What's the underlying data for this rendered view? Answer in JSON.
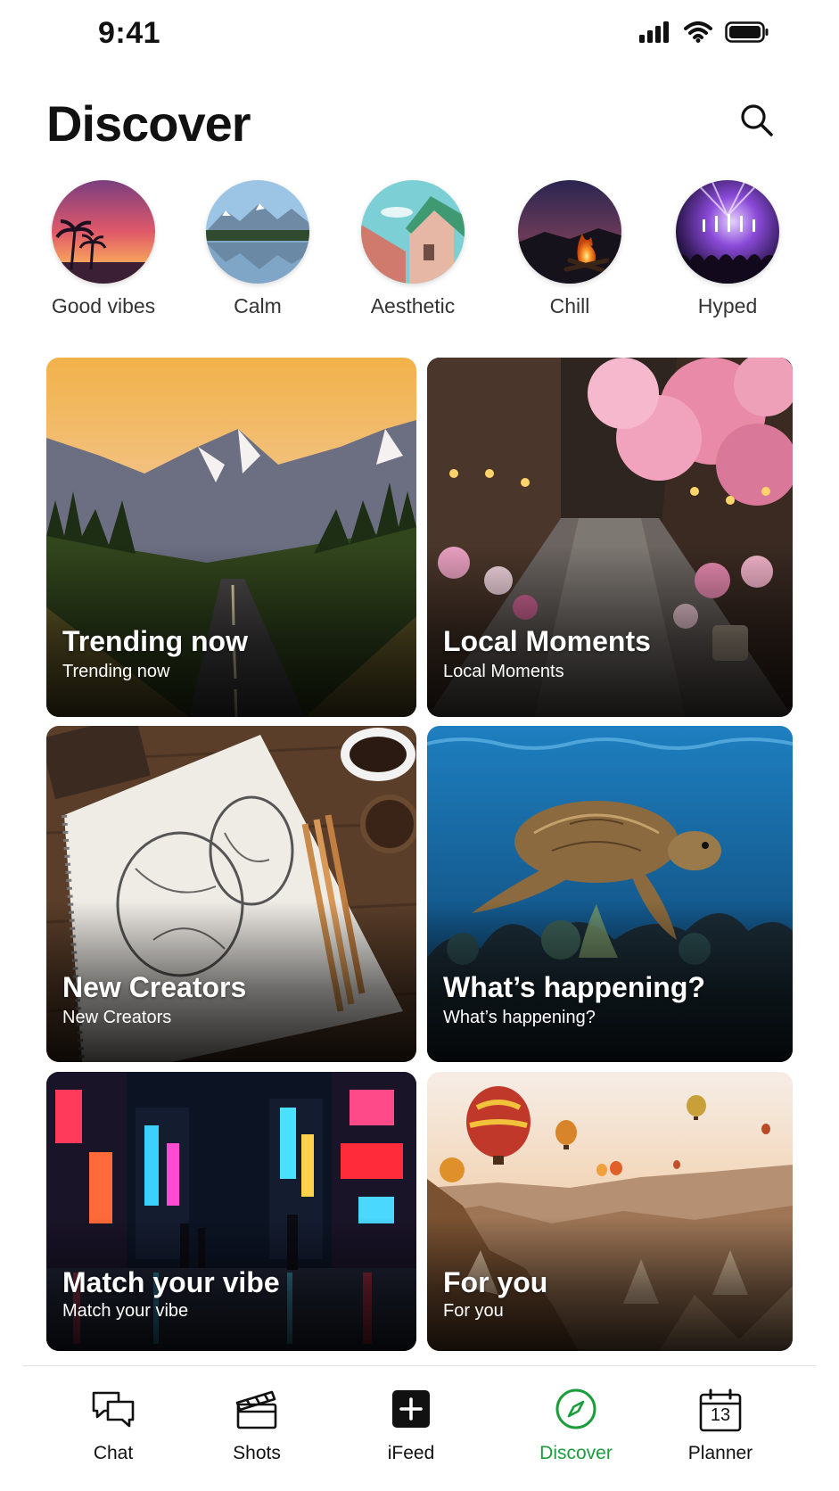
{
  "status_bar": {
    "time": "9:41"
  },
  "header": {
    "title": "Discover"
  },
  "moods": [
    {
      "label": "Good vibes"
    },
    {
      "label": "Calm"
    },
    {
      "label": "Aesthetic"
    },
    {
      "label": "Chill"
    },
    {
      "label": "Hyped"
    }
  ],
  "cards": [
    {
      "title": "Trending now",
      "subtitle": "Trending now"
    },
    {
      "title": "Local Moments",
      "subtitle": "Local Moments"
    },
    {
      "title": "New Creators",
      "subtitle": "New Creators"
    },
    {
      "title": "What’s happening?",
      "subtitle": "What’s happening?"
    },
    {
      "title": "Match your vibe",
      "subtitle": "Match your vibe"
    },
    {
      "title": "For you",
      "subtitle": "For you"
    }
  ],
  "tabbar": {
    "items": [
      {
        "label": "Chat",
        "icon": "chat-bubbles-icon"
      },
      {
        "label": "Shots",
        "icon": "clapperboard-icon"
      },
      {
        "label": "iFeed",
        "icon": "plus-square-icon"
      },
      {
        "label": "Discover",
        "icon": "compass-icon"
      },
      {
        "label": "Planner",
        "icon": "calendar-icon",
        "day": "13"
      }
    ],
    "active": "Discover",
    "active_color": "#1a9e3c"
  }
}
